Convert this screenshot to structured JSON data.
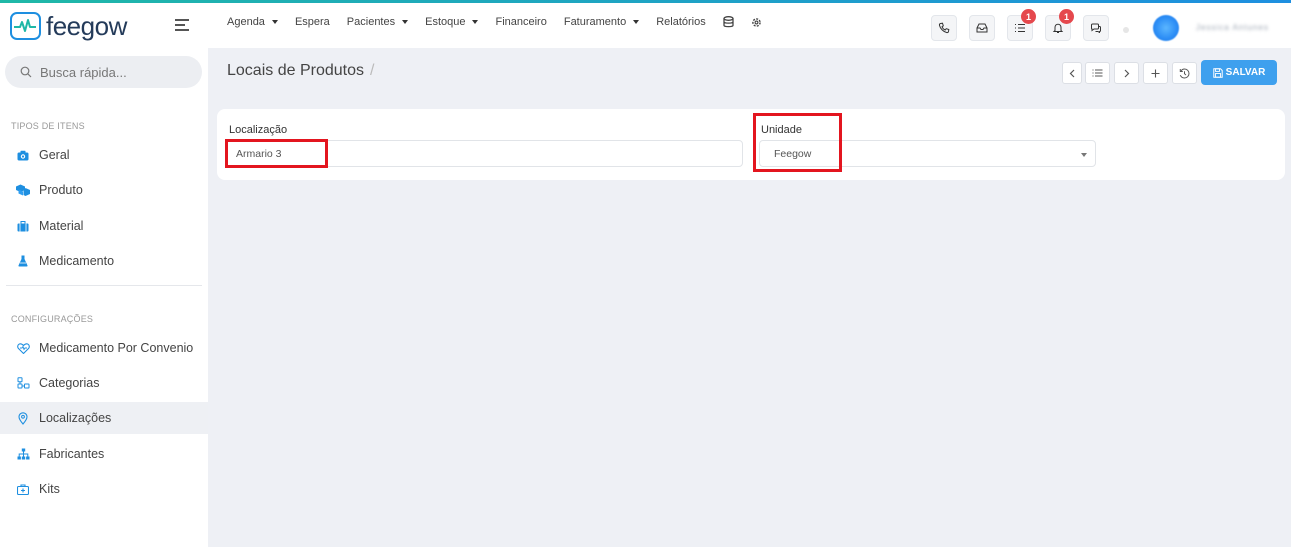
{
  "app": {
    "logo_text": "feegow",
    "brand_color": "#1e8fe0",
    "accent_color": "#3ea0ee",
    "alert_color": "#e3151f"
  },
  "topnav": {
    "items": [
      {
        "label": "Agenda",
        "dropdown": true
      },
      {
        "label": "Espera",
        "dropdown": false
      },
      {
        "label": "Pacientes",
        "dropdown": true
      },
      {
        "label": "Estoque",
        "dropdown": true
      },
      {
        "label": "Financeiro",
        "dropdown": false
      },
      {
        "label": "Faturamento",
        "dropdown": true
      },
      {
        "label": "Relatórios",
        "dropdown": false
      }
    ],
    "icons": [
      "database-icon",
      "gear-icon"
    ]
  },
  "header_actions": {
    "tasks_badge": "1",
    "notifications_badge": "1",
    "user_name": "Jessica Antunes"
  },
  "sidebar": {
    "search_placeholder": "Busca rápida...",
    "section1_title": "TIPOS DE ITENS",
    "section1_items": [
      {
        "label": "Geral",
        "icon": "camera-icon"
      },
      {
        "label": "Produto",
        "icon": "cubes-icon"
      },
      {
        "label": "Material",
        "icon": "briefcase-icon"
      },
      {
        "label": "Medicamento",
        "icon": "flask-icon"
      }
    ],
    "section2_title": "CONFIGURAÇÕES",
    "section2_items": [
      {
        "label": "Medicamento Por Convenio",
        "icon": "heart-shield-icon"
      },
      {
        "label": "Categorias",
        "icon": "categories-icon"
      },
      {
        "label": "Localizações",
        "icon": "map-pin-icon",
        "active": true
      },
      {
        "label": "Fabricantes",
        "icon": "sitemap-icon"
      },
      {
        "label": "Kits",
        "icon": "medkit-icon"
      }
    ]
  },
  "page": {
    "title": "Locais de Produtos",
    "breadcrumb_sep": "/",
    "save_label": "SALVAR"
  },
  "form": {
    "localizacao_label": "Localização",
    "localizacao_value": "Armario 3",
    "unidade_label": "Unidade",
    "unidade_value": "Feegow"
  }
}
